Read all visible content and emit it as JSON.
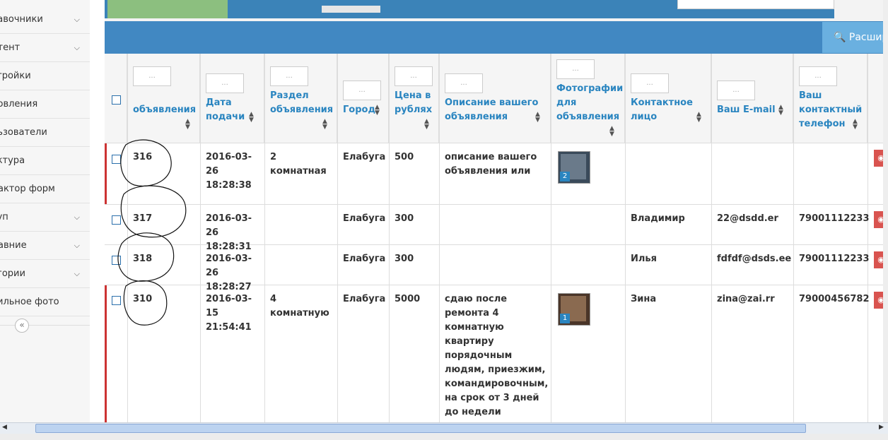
{
  "sidebar": {
    "items": [
      {
        "label": "равочники",
        "chevron": true
      },
      {
        "label": "нтент",
        "chevron": true
      },
      {
        "label": "стройки",
        "chevron": false
      },
      {
        "label": "новления",
        "chevron": false
      },
      {
        "label": "льзователи",
        "chevron": false
      },
      {
        "label": "уктура",
        "chevron": false
      },
      {
        "label": "дактор форм",
        "chevron": false
      },
      {
        "label": "туп",
        "chevron": true
      },
      {
        "label": "давние",
        "chevron": true
      },
      {
        "label": "егории",
        "chevron": true
      },
      {
        "label": "бильное фото",
        "chevron": false
      }
    ],
    "collapse_glyph": "«"
  },
  "header": {
    "search_button_label": "Расшир"
  },
  "table": {
    "filter_placeholder": "...",
    "columns": [
      {
        "label": "объявления"
      },
      {
        "label": "Дата подачи"
      },
      {
        "label": "Раздел объявления"
      },
      {
        "label": "Город"
      },
      {
        "label": "Цена в рублях"
      },
      {
        "label": "Описание вашего объявления"
      },
      {
        "label": "Фотографии для объявления"
      },
      {
        "label": "Контактное лицо"
      },
      {
        "label": "Ваш E-mail"
      },
      {
        "label": "Ваш контактный телефон"
      }
    ],
    "rows": [
      {
        "id": "316",
        "date": "2016-03-26 18:28:38",
        "section": "2 комнатная",
        "city": "Елабуга",
        "price": "500",
        "description": "описание вашего объявления или",
        "photo_count": "2",
        "contact": "",
        "email": "",
        "phone": ""
      },
      {
        "id": "317",
        "date": "2016-03-26 18:28:31",
        "section": "",
        "city": "Елабуга",
        "price": "300",
        "description": "",
        "photo_count": "",
        "contact": "Владимир",
        "email": "22@dsdd.er",
        "phone": "79001112233"
      },
      {
        "id": "318",
        "date": "2016-03-26 18:28:27",
        "section": "",
        "city": "Елабуга",
        "price": "300",
        "description": "",
        "photo_count": "",
        "contact": "Илья",
        "email": "fdfdf@dsds.ee",
        "phone": "79001112233"
      },
      {
        "id": "310",
        "date": "2016-03-15 21:54:41",
        "section": "4 комнатную",
        "city": "Елабуга",
        "price": "5000",
        "description": "сдаю после ремонта 4 комнатную квартиру порядочным людям, приезжим, командировочным, на срок от 3 дней до недели",
        "photo_count": "1",
        "contact": "Зина",
        "email": "zina@zai.rr",
        "phone": "79000456782"
      }
    ]
  },
  "colors": {
    "header_blue": "#4188c2",
    "link_blue": "#2a85c0",
    "green": "#8cbf7f",
    "danger": "#d9534f"
  }
}
